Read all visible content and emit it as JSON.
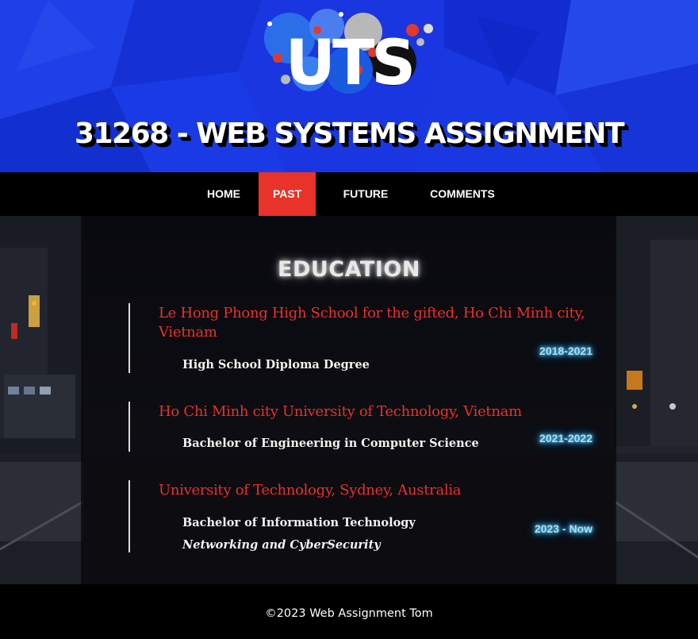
{
  "header": {
    "logo_text": "UTS",
    "title": "31268 - WEB SYSTEMS ASSIGNMENT"
  },
  "nav": {
    "items": [
      {
        "label": "HOME",
        "active": false
      },
      {
        "label": "PAST",
        "active": true
      },
      {
        "label": "FUTURE",
        "active": false
      },
      {
        "label": "COMMENTS",
        "active": false
      }
    ]
  },
  "education": {
    "title": "EDUCATION",
    "entries": [
      {
        "school": "Le Hong Phong High School for the gifted, Ho Chi Minh city, Vietnam",
        "degree": "High School Diploma Degree",
        "period": "2018-2021"
      },
      {
        "school": "Ho Chi Minh city University of Technology, Vietnam",
        "degree": "Bachelor of Engineering in Computer Science",
        "period": "2021-2022"
      },
      {
        "school": "University of Technology, Sydney, Australia",
        "degree": "Bachelor of Information Technology",
        "major": "Networking and CyberSecurity",
        "period": "2023 - Now"
      }
    ]
  },
  "footer": {
    "text": "©2023 Web Assignment Tom"
  },
  "colors": {
    "header_blue": "#1a36e0",
    "accent_red": "#e8322a",
    "period_glow": "#6fd3ff"
  }
}
